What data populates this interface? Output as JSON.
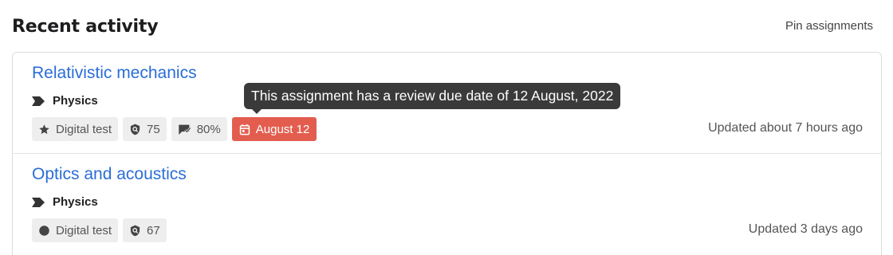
{
  "header": {
    "title": "Recent activity",
    "pin_label": "Pin assignments"
  },
  "items": [
    {
      "title": "Relativistic mechanics",
      "subject": "Physics",
      "type_label": "Digital test",
      "type_icon": "star-icon",
      "score": "75",
      "progress": "80%",
      "due": "August 12",
      "updated": "Updated about 7 hours ago"
    },
    {
      "title": "Optics and acoustics",
      "subject": "Physics",
      "type_label": "Digital test",
      "type_icon": "circle-icon",
      "score": "67",
      "updated": "Updated 3 days ago"
    }
  ],
  "tooltip": {
    "text": "This assignment has a review due date of 12 August, 2022"
  },
  "colors": {
    "link": "#2a6dd6",
    "due_badge": "#e35d4f",
    "tooltip_bg": "#3a3a3a"
  }
}
